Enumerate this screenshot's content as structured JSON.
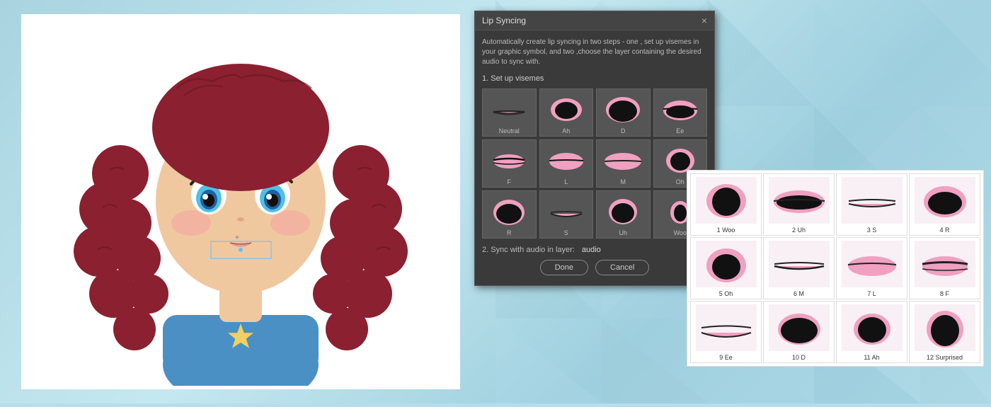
{
  "background": {
    "color": "#b8dde8"
  },
  "dialog": {
    "title": "Lip Syncing",
    "close_icon": "×",
    "description": "Automatically create lip syncing in two steps - one , set up visemes in your graphic symbol, and two ,choose the layer containing the desired audio to sync with.",
    "section1_label": "1. Set up visemes",
    "section2_label": "2. Sync with audio in layer:",
    "audio_value": "audio",
    "done_label": "Done",
    "cancel_label": "Cancel",
    "visemes": [
      {
        "label": "Neutral"
      },
      {
        "label": "Ah"
      },
      {
        "label": "D"
      },
      {
        "label": "Ee"
      },
      {
        "label": "F"
      },
      {
        "label": "L"
      },
      {
        "label": "M"
      },
      {
        "label": "Oh"
      },
      {
        "label": "R"
      },
      {
        "label": "S"
      },
      {
        "label": "Uh"
      },
      {
        "label": "Woo"
      }
    ]
  },
  "extended_panel": {
    "visemes": [
      {
        "label": "1 Woo"
      },
      {
        "label": "2 Uh"
      },
      {
        "label": "3 S"
      },
      {
        "label": "4 R"
      },
      {
        "label": "5 Oh"
      },
      {
        "label": "6 M"
      },
      {
        "label": "7 L"
      },
      {
        "label": "8 F"
      },
      {
        "label": "9 Ee"
      },
      {
        "label": "10 D"
      },
      {
        "label": "11 Ah"
      },
      {
        "label": "12 Surprised"
      }
    ]
  }
}
